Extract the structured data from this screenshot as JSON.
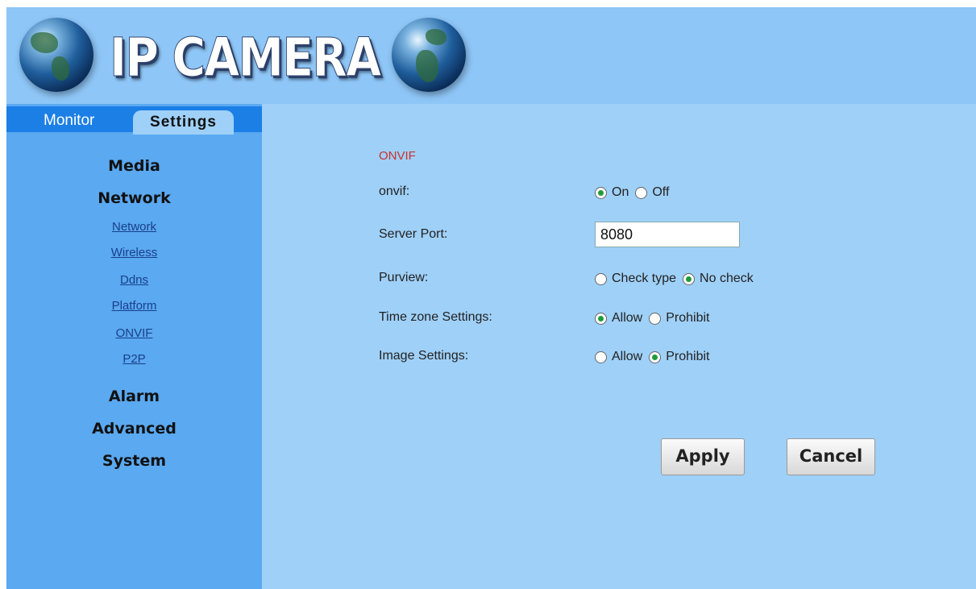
{
  "header": {
    "logo_text": "IP CAMERA"
  },
  "tabs": {
    "monitor": "Monitor",
    "settings": "Settings"
  },
  "sidebar": {
    "media": "Media",
    "network": "Network",
    "network_links": [
      "Network",
      "Wireless",
      "Ddns",
      "Platform",
      "ONVIF",
      "P2P"
    ],
    "alarm": "Alarm",
    "advanced": "Advanced",
    "system": "System"
  },
  "form": {
    "title": "ONVIF",
    "onvif": {
      "label": "onvif:",
      "options": [
        "On",
        "Off"
      ],
      "selected": "On"
    },
    "server_port": {
      "label": "Server Port:",
      "value": "8080"
    },
    "purview": {
      "label": "Purview:",
      "options": [
        "Check type",
        "No check"
      ],
      "selected": "No check"
    },
    "time_zone": {
      "label": "Time zone Settings:",
      "options": [
        "Allow",
        "Prohibit"
      ],
      "selected": "Allow"
    },
    "image": {
      "label": "Image Settings:",
      "options": [
        "Allow",
        "Prohibit"
      ],
      "selected": "Prohibit"
    }
  },
  "buttons": {
    "apply": "Apply",
    "cancel": "Cancel"
  },
  "colors": {
    "header_bg": "#8ec6f7",
    "sidebar_bg": "#5aa9f1",
    "tabbar_bg": "#1c7fe6",
    "content_bg": "#9fd0f8",
    "title_red": "#c8312d",
    "radio_green": "#1f9b3a"
  }
}
